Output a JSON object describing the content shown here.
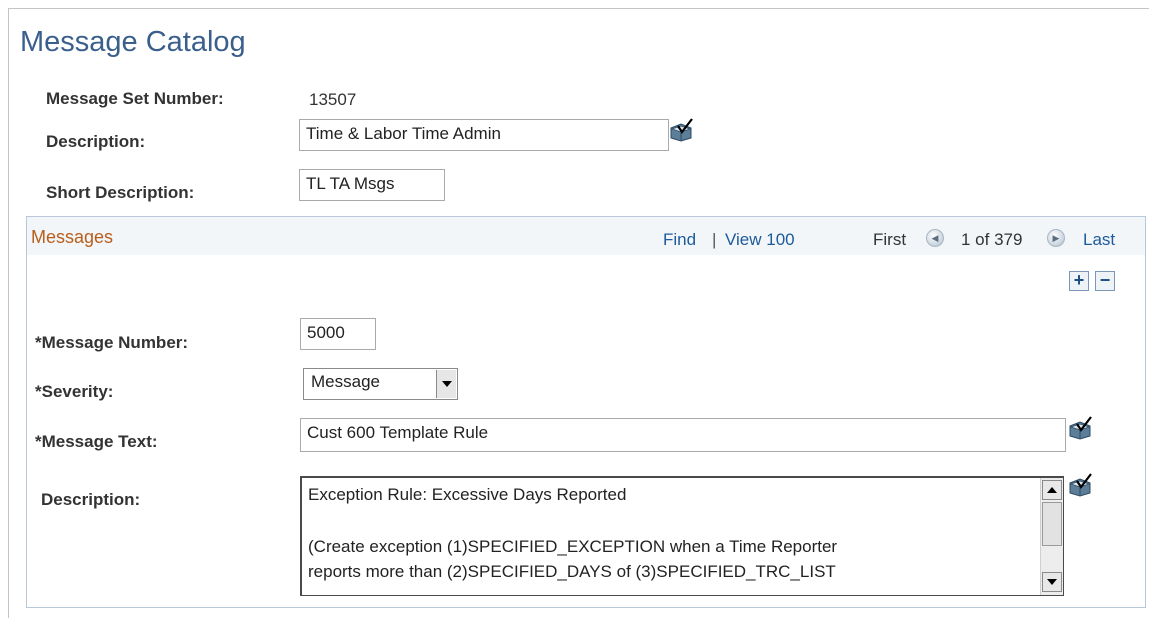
{
  "page": {
    "title": "Message Catalog"
  },
  "header": {
    "message_set_number_label": "Message Set Number:",
    "message_set_number_value": "13507",
    "description_label": "Description:",
    "description_value": "Time & Labor Time Admin",
    "short_description_label": "Short Description:",
    "short_description_value": "TL TA Msgs"
  },
  "grid": {
    "title": "Messages",
    "find_label": "Find",
    "separator": "|",
    "view_label": "View 100",
    "first_label": "First",
    "position_text": "1 of 379",
    "last_label": "Last",
    "add_row_label": "+",
    "delete_row_label": "−"
  },
  "message": {
    "number_label": "*Message Number:",
    "number_value": "5000",
    "severity_label": "*Severity:",
    "severity_value": "Message",
    "text_label": "*Message Text:",
    "text_value": "Cust 600 Template Rule",
    "description_label": "Description:",
    "description_lines": [
      "Exception Rule: Excessive Days Reported",
      "",
      "(Create exception (1)SPECIFIED_EXCEPTION when a Time Reporter",
      "reports more than (2)SPECIFIED_DAYS of (3)SPECIFIED_TRC_LIST"
    ]
  },
  "icons": {
    "spellcheck": "spellcheck-icon",
    "prev": "previous-arrow-icon",
    "next": "next-arrow-icon",
    "dropdown": "chevron-down-icon"
  },
  "colors": {
    "title": "#3a5f8c",
    "grid_title": "#b85e1b",
    "link": "#1d5b9a",
    "grid_header_bg": "#f2f6f9"
  }
}
